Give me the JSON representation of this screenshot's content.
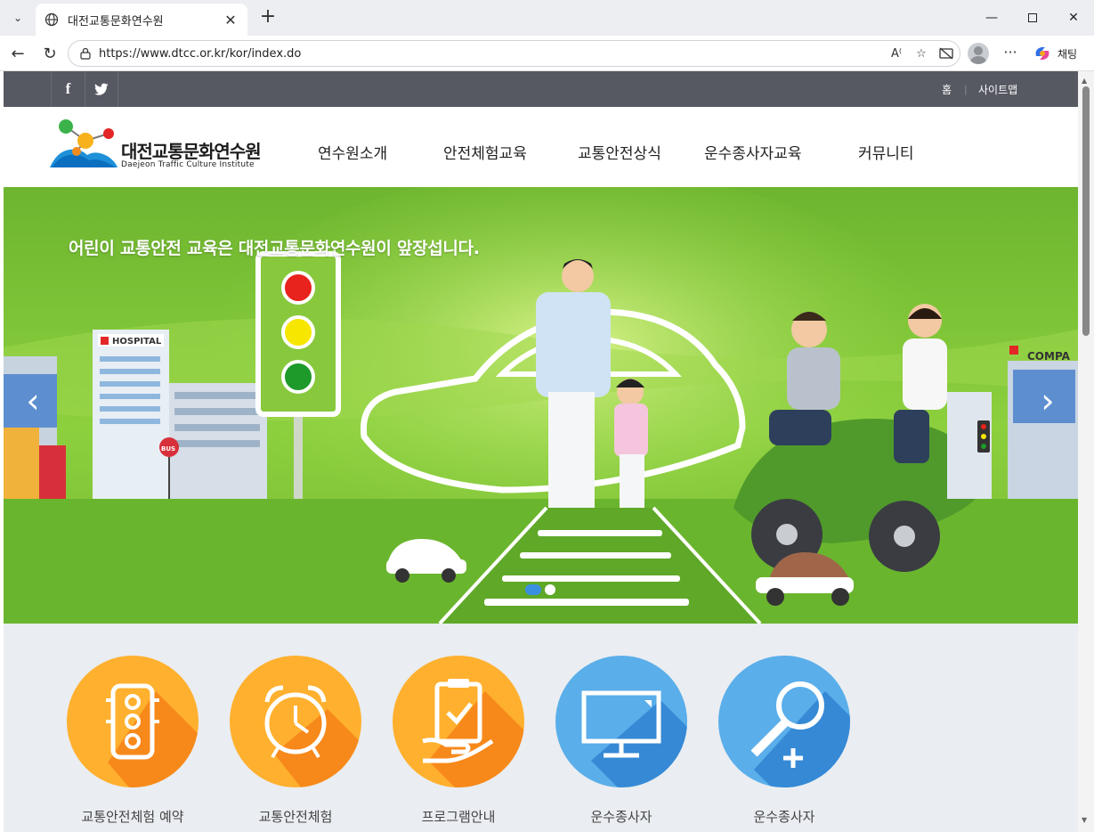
{
  "browser": {
    "tab_title": "대전교통문화연수원",
    "url": "https://www.dtcc.or.kr/kor/index.do",
    "chat_label": "채팅",
    "window_controls": [
      "minimize-icon",
      "maximize-icon",
      "close-icon"
    ]
  },
  "topbar": {
    "sns": [
      "f",
      "twitter-icon"
    ],
    "links": {
      "home": "홈",
      "sitemap": "사이트맵"
    }
  },
  "header": {
    "logo_kr": "대전교통문화연수원",
    "logo_en": "Daejeon Traffic Culture Institute",
    "nav": [
      "연수원소개",
      "안전체험교육",
      "교통안전상식",
      "운수종사자교육",
      "커뮤니티"
    ]
  },
  "hero": {
    "headline": "어린이 교통안전 교육은 대전교통문화연수원이 앞장섭니다.",
    "signs": {
      "hospital": "HOSPITAL",
      "company": "COMPA",
      "bus": "BUS"
    },
    "slide_count": 2,
    "active_slide": 1,
    "colors": {
      "green": "#79c23a",
      "dot_active": "#3b8fe0",
      "dot_inactive": "#ffffff"
    }
  },
  "quick_menu": [
    {
      "label": "교통안전체험 예약",
      "icon": "traffic-light-icon",
      "color": "#ffb02e"
    },
    {
      "label": "교통안전체험",
      "icon": "alarm-clock-icon",
      "color": "#ffb02e"
    },
    {
      "label": "프로그램안내",
      "icon": "clipboard-check-icon",
      "color": "#ffb02e"
    },
    {
      "label": "운수종사자",
      "icon": "monitor-icon",
      "color": "#5aaeea"
    },
    {
      "label": "운수종사자",
      "icon": "magnifier-plus-icon",
      "color": "#5aaeea"
    }
  ]
}
